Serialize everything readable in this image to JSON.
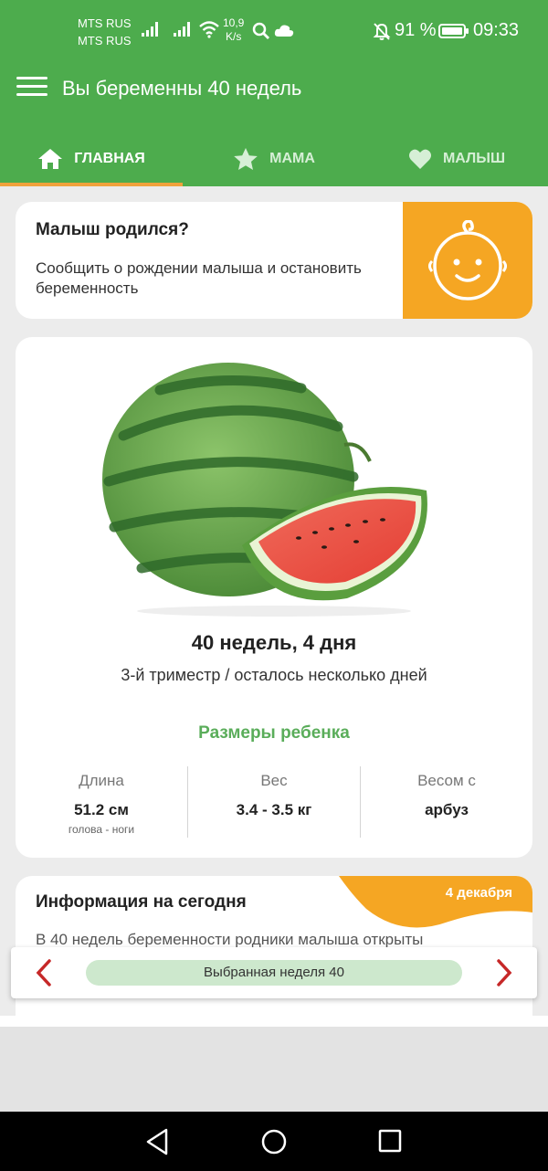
{
  "status_bar": {
    "carrier1": "MTS RUS",
    "carrier2": "MTS RUS",
    "speed_value": "10,9",
    "speed_unit": "K/s",
    "battery_percent": "91 %",
    "time": "09:33"
  },
  "app_bar": {
    "title": "Вы беременны 40 недель",
    "menu_icon": "hamburger-icon"
  },
  "tabs": [
    {
      "label": "ГЛАВНАЯ",
      "icon": "home-icon",
      "active": true
    },
    {
      "label": "МАМА",
      "icon": "star-icon",
      "active": false
    },
    {
      "label": "МАЛЫШ",
      "icon": "heart-icon",
      "active": false
    }
  ],
  "baby_born": {
    "title": "Малыш родился?",
    "text": "Сообщить о рождении малыша и остановить беременность",
    "icon": "baby-face-icon"
  },
  "week_info": {
    "title": "40 недель, 4 дня",
    "subtitle": "3-й триместр / осталось несколько дней",
    "sizes_heading": "Размеры ребенка",
    "stats": [
      {
        "label": "Длина",
        "value": "51.2 см",
        "note": "голова - ноги"
      },
      {
        "label": "Вес",
        "value": "3.4 - 3.5 кг",
        "note": ""
      },
      {
        "label": "Весом с",
        "value": "арбуз",
        "note": ""
      }
    ]
  },
  "today_info": {
    "title": "Информация на сегодня",
    "date": "4 декабря",
    "text": "В 40 недель беременности родники малыша открыты"
  },
  "week_selector": {
    "label": "Выбранная неделя 40"
  },
  "colors": {
    "primary_green": "#4dac4d",
    "accent_orange": "#f5a623",
    "tab_indicator": "#f0a23c",
    "sizes_heading": "#5aad5a",
    "arrow_red": "#c62828"
  }
}
